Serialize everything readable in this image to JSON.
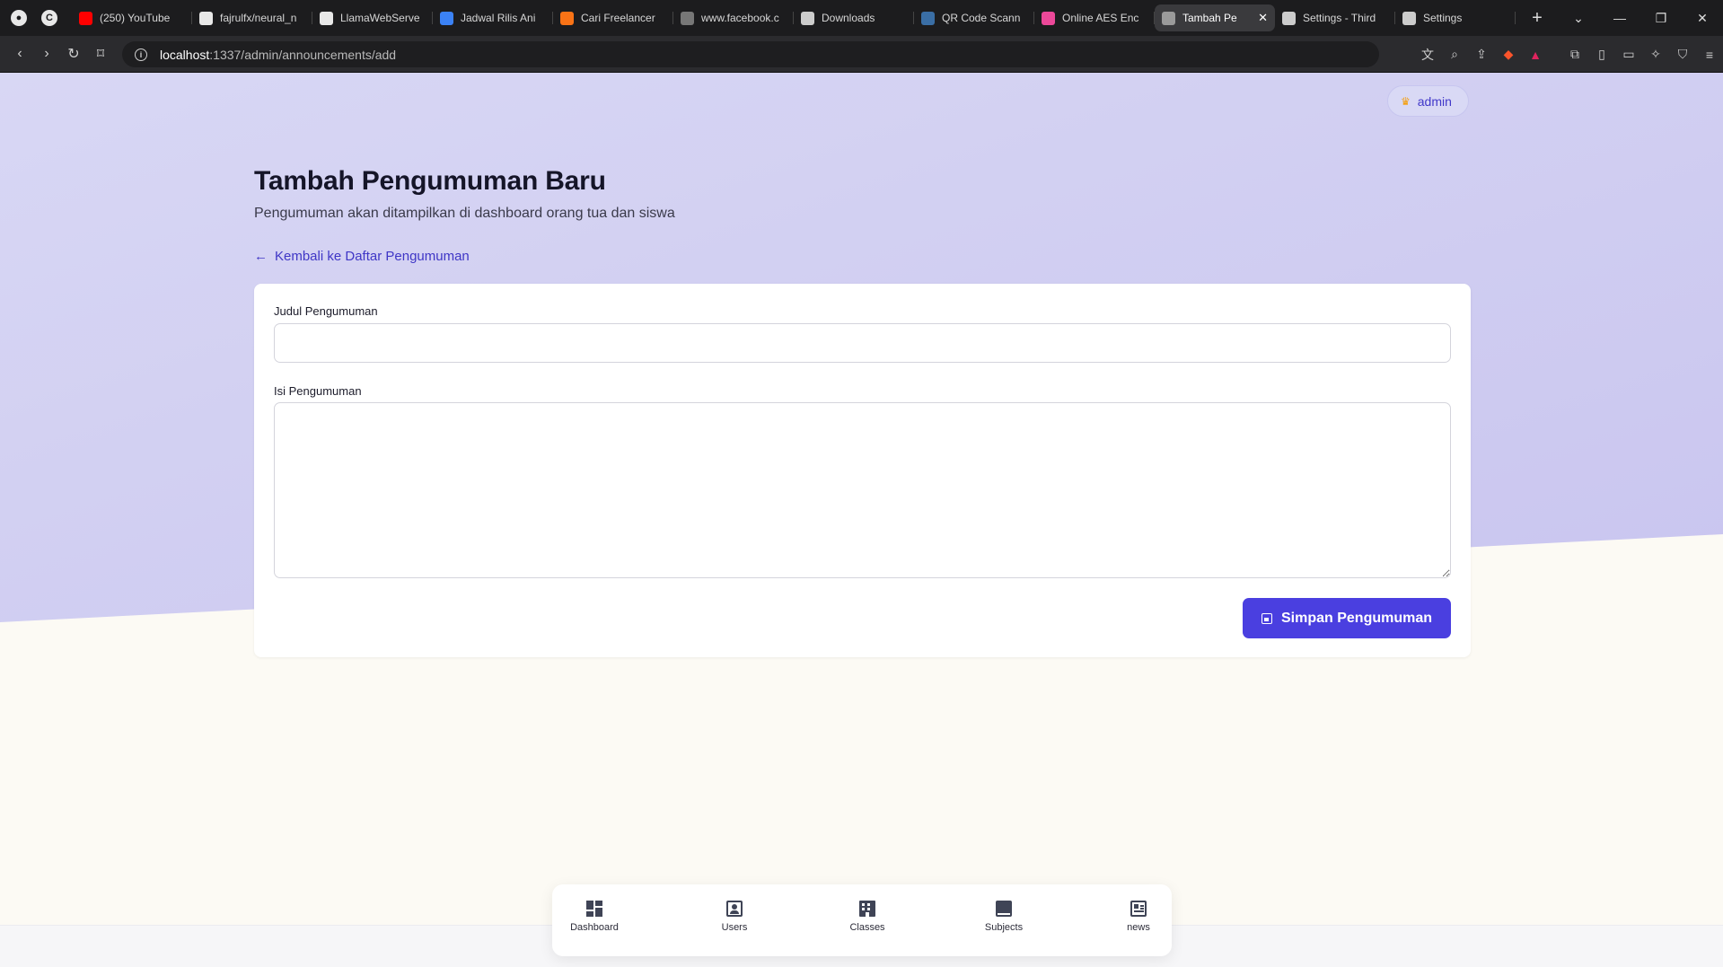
{
  "browser": {
    "tabs": [
      {
        "title": "(250) YouTube",
        "icon": "youtube-icon",
        "color": "#ff0000"
      },
      {
        "title": "fajrulfx/neural_n",
        "icon": "github-icon",
        "color": "#e8e8e8"
      },
      {
        "title": "LlamaWebServe",
        "icon": "github-icon",
        "color": "#e8e8e8"
      },
      {
        "title": "Jadwal Rilis Ani",
        "icon": "calendar-icon",
        "color": "#3b82f6"
      },
      {
        "title": "Cari Freelancer",
        "icon": "freelancer-icon",
        "color": "#f97316"
      },
      {
        "title": "www.facebook.c",
        "icon": "facebook-icon",
        "color": "#777777"
      },
      {
        "title": "Downloads",
        "icon": "download-icon",
        "color": "#cccccc"
      },
      {
        "title": "QR Code Scann",
        "icon": "qr-icon",
        "color": "#3a6ea5"
      },
      {
        "title": "Online AES Enc",
        "icon": "aes-icon",
        "color": "#ec4899"
      },
      {
        "title": "Tambah Pe",
        "icon": "globe-icon",
        "color": "#9a9a9a",
        "active": true
      },
      {
        "title": "Settings - Third",
        "icon": "gear-icon",
        "color": "#cccccc"
      },
      {
        "title": "Settings",
        "icon": "gear-icon",
        "color": "#cccccc"
      }
    ],
    "url_host": "localhost",
    "url_rest": ":1337/admin/announcements/add"
  },
  "page": {
    "user_badge": "admin",
    "title": "Tambah Pengumuman Baru",
    "subtitle": "Pengumuman akan ditampilkan di dashboard orang tua dan siswa",
    "back_link": "Kembali ke Daftar Pengumuman",
    "form": {
      "title_label": "Judul Pengumuman",
      "title_value": "",
      "body_label": "Isi Pengumuman",
      "body_value": "",
      "submit_label": "Simpan Pengumuman"
    }
  },
  "bottom_nav": [
    {
      "label": "Dashboard",
      "icon": "dashboard-icon"
    },
    {
      "label": "Users",
      "icon": "users-icon"
    },
    {
      "label": "Classes",
      "icon": "building-icon"
    },
    {
      "label": "Subjects",
      "icon": "book-icon"
    },
    {
      "label": "news",
      "icon": "news-icon"
    }
  ],
  "colors": {
    "accent": "#4a3fe0",
    "link": "#3f36c6",
    "hero_bg": "#d6d5f3",
    "page_bg": "#fcfaf4"
  }
}
